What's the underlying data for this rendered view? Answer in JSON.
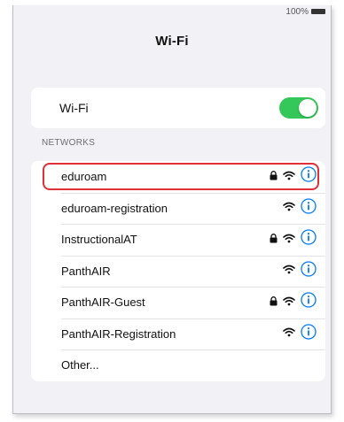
{
  "status_bar": {
    "battery_text": "100%"
  },
  "nav": {
    "title": "Wi-Fi"
  },
  "wifi_toggle": {
    "label": "Wi-Fi",
    "on": true
  },
  "networks": {
    "header": "NETWORKS",
    "items": [
      {
        "label": "eduroam",
        "locked": true,
        "highlighted": true
      },
      {
        "label": "eduroam-registration",
        "locked": false
      },
      {
        "label": "InstructionalAT",
        "locked": true
      },
      {
        "label": "PanthAIR",
        "locked": false
      },
      {
        "label": "PanthAIR-Guest",
        "locked": true
      },
      {
        "label": "PanthAIR-Registration",
        "locked": false
      },
      {
        "label": "Other...",
        "locked": false,
        "other": true
      }
    ]
  },
  "colors": {
    "accent": "#007aff",
    "toggle_on": "#34c759",
    "highlight": "#e0303a",
    "background": "#f1f1f6"
  }
}
